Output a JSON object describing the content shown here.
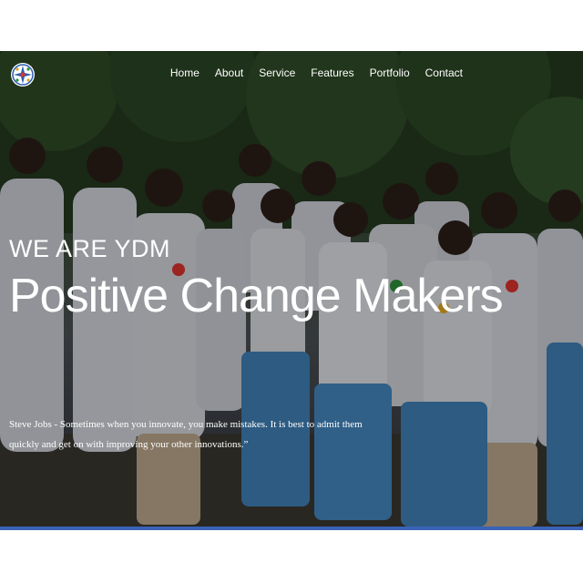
{
  "nav": {
    "logo_icon": "ydm-logo-icon",
    "links": [
      "Home",
      "About",
      "Service",
      "Features",
      "Portfolio",
      "Contact"
    ]
  },
  "hero": {
    "eyebrow": "WE ARE YDM",
    "headline": "Positive Change Makers",
    "quote": "Steve Jobs - Sometimes when you innovate, you make mistakes. It is best to admit them quickly and get on with improving your other innovations.”",
    "photo_description_icon": "group-photo-image"
  },
  "colors": {
    "accent_bar": "#3a63b8",
    "text": "#ffffff"
  }
}
